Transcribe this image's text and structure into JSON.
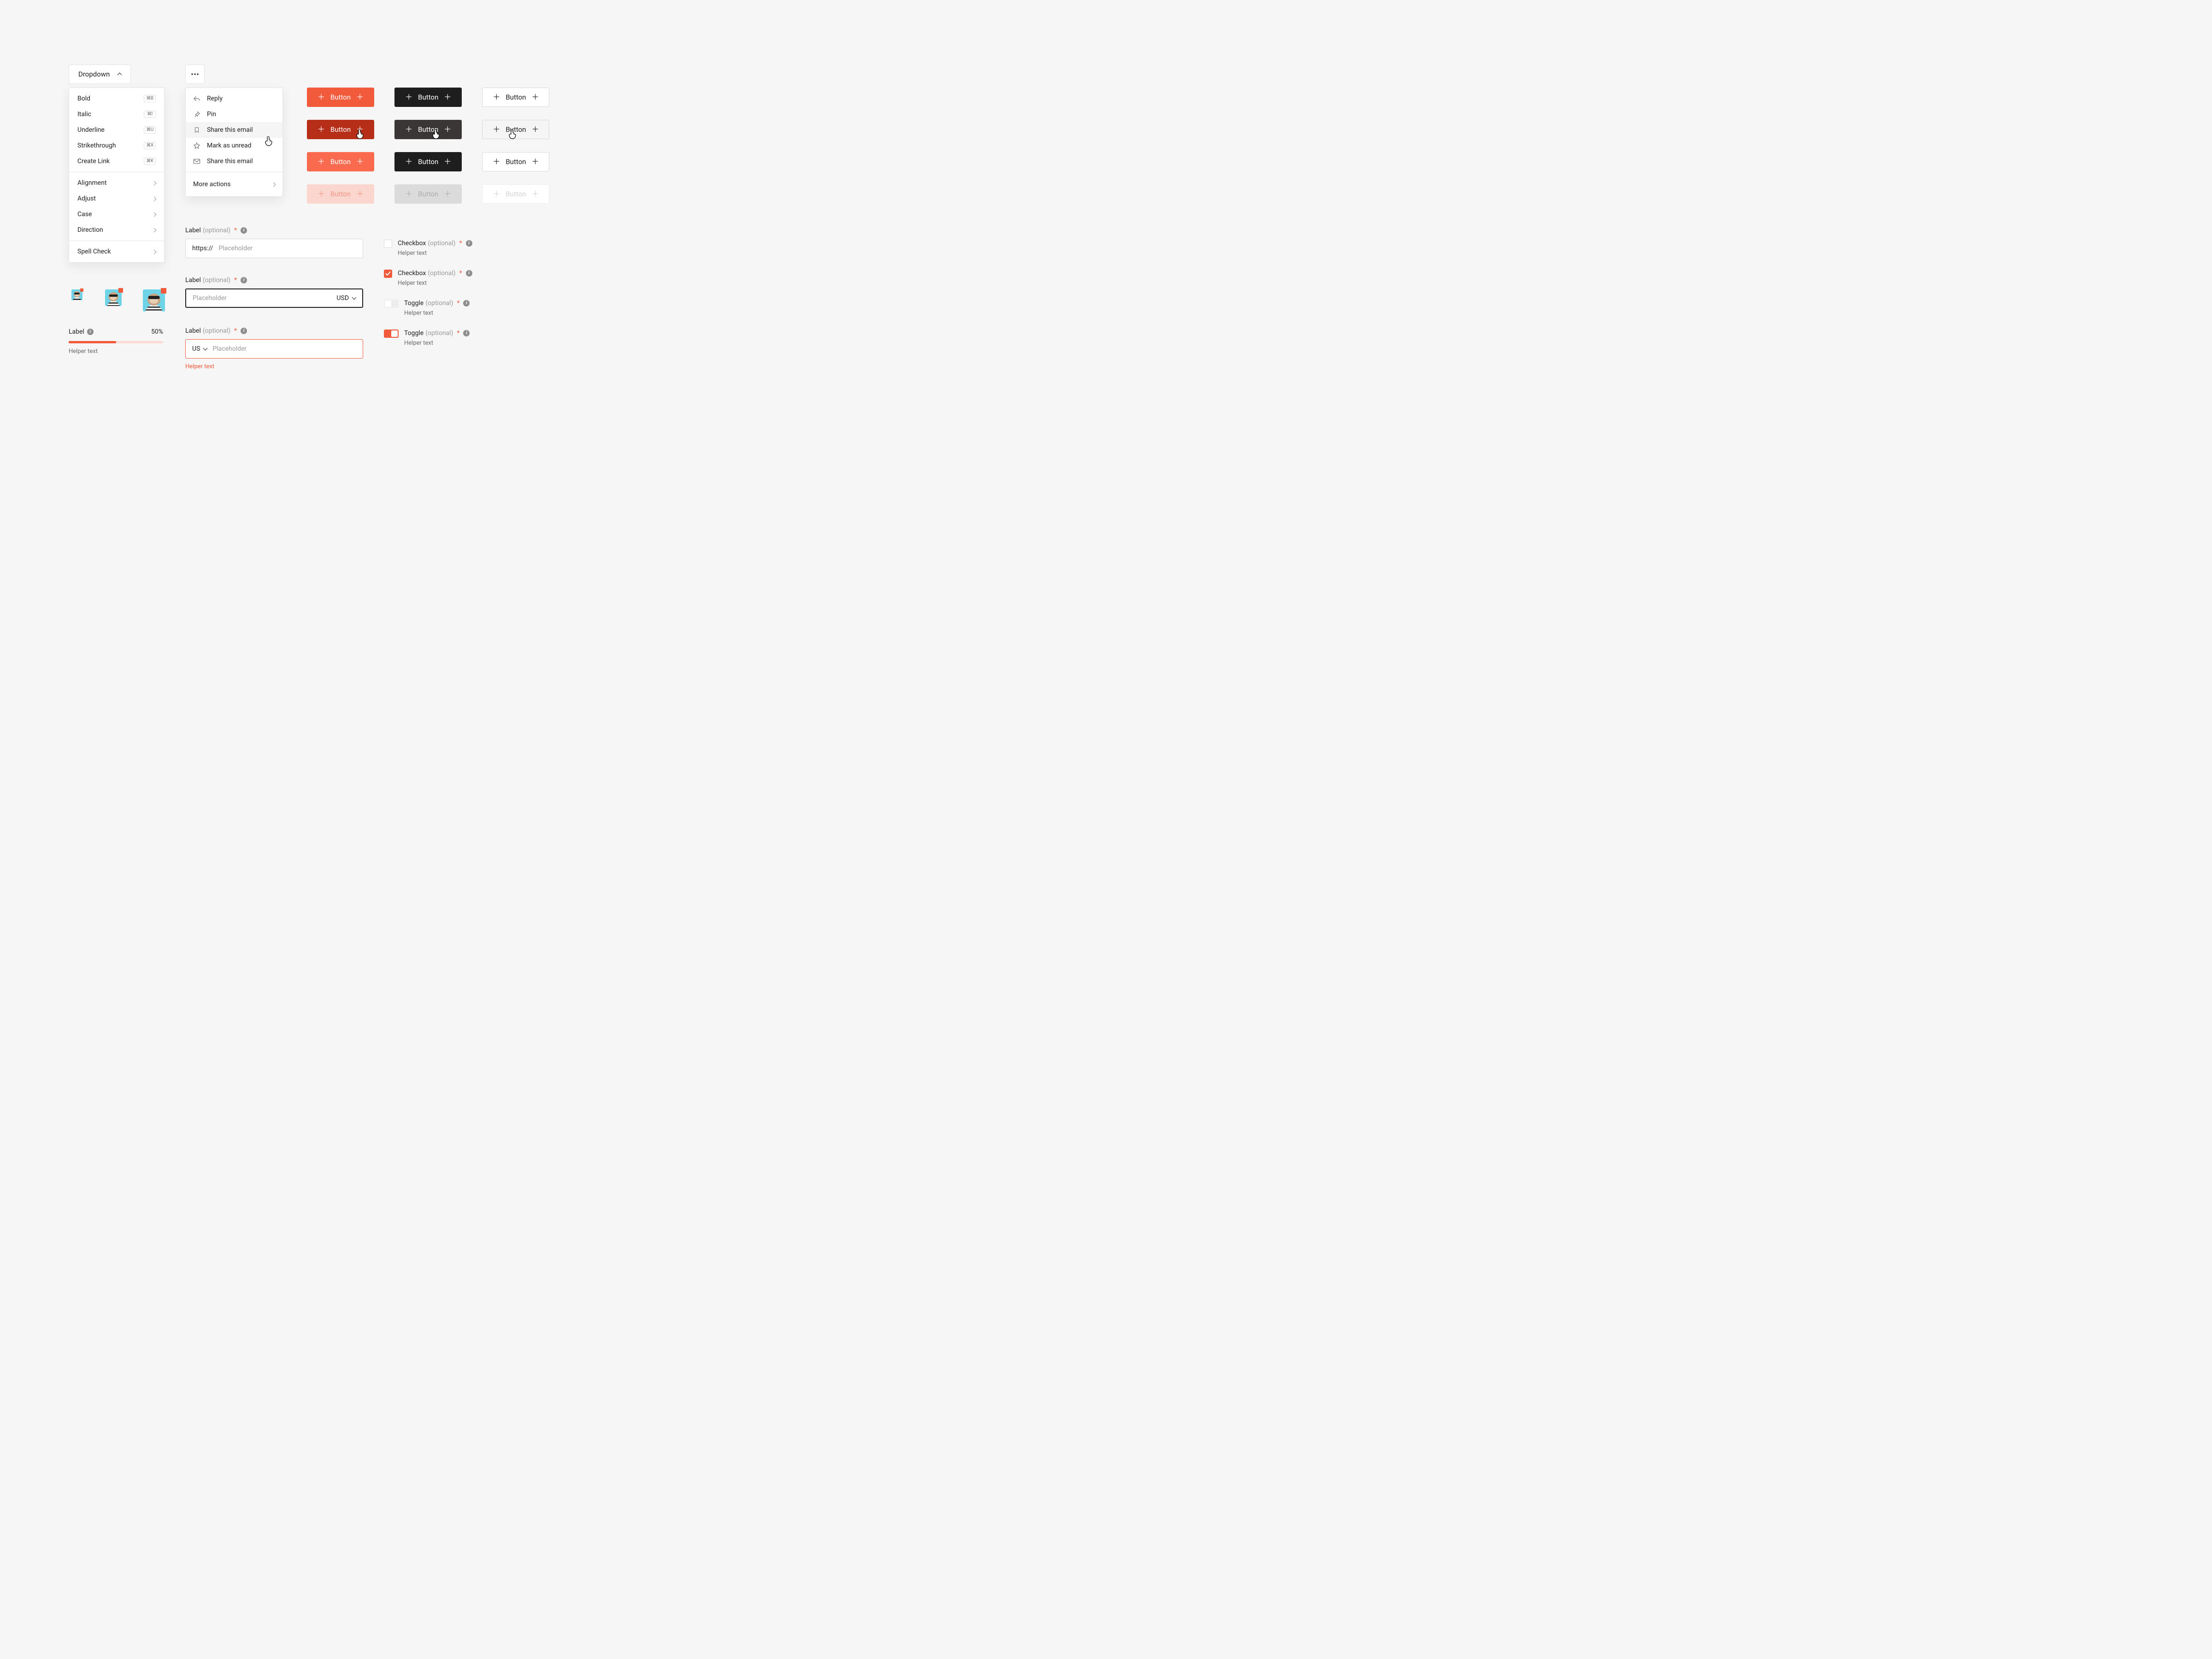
{
  "dropdown": {
    "label": "Dropdown",
    "sections": [
      [
        {
          "label": "Bold",
          "kbd": "⌘B"
        },
        {
          "label": "Italic",
          "kbd": "⌘I"
        },
        {
          "label": "Underline",
          "kbd": "⌘U"
        },
        {
          "label": "Strikethrough",
          "kbd": "⌘X"
        },
        {
          "label": "Create Link",
          "kbd": "⌘K"
        }
      ],
      [
        {
          "label": "Alignment",
          "submenu": true
        },
        {
          "label": "Adjust",
          "submenu": true
        },
        {
          "label": "Case",
          "submenu": true
        },
        {
          "label": "Direction",
          "submenu": true
        }
      ],
      [
        {
          "label": "Spell Check",
          "submenu": true
        }
      ]
    ]
  },
  "overflow_menu": {
    "items": [
      {
        "label": "Reply",
        "icon": "reply-icon"
      },
      {
        "label": "Pin",
        "icon": "pin-icon"
      },
      {
        "label": "Share this email",
        "icon": "bookmark-icon",
        "hover": true
      },
      {
        "label": "Mark as unread",
        "icon": "star-icon"
      },
      {
        "label": "Share this email",
        "icon": "mail-icon"
      }
    ],
    "more": "More actions"
  },
  "button_label": "Button",
  "fields": {
    "label": "Label",
    "optional": "(optional)",
    "placeholder": "Placeholder",
    "prefix_https": "https://",
    "currency": "USD",
    "country": "US",
    "helper": "Helper text"
  },
  "progress": {
    "label": "Label",
    "value": "50%",
    "percent": 50,
    "helper": "Helper text"
  },
  "checkbox": {
    "label": "Checkbox",
    "optional": "(optional)",
    "helper": "Helper text"
  },
  "toggle": {
    "label": "Toggle",
    "optional": "(optional)",
    "helper": "Helper text"
  }
}
